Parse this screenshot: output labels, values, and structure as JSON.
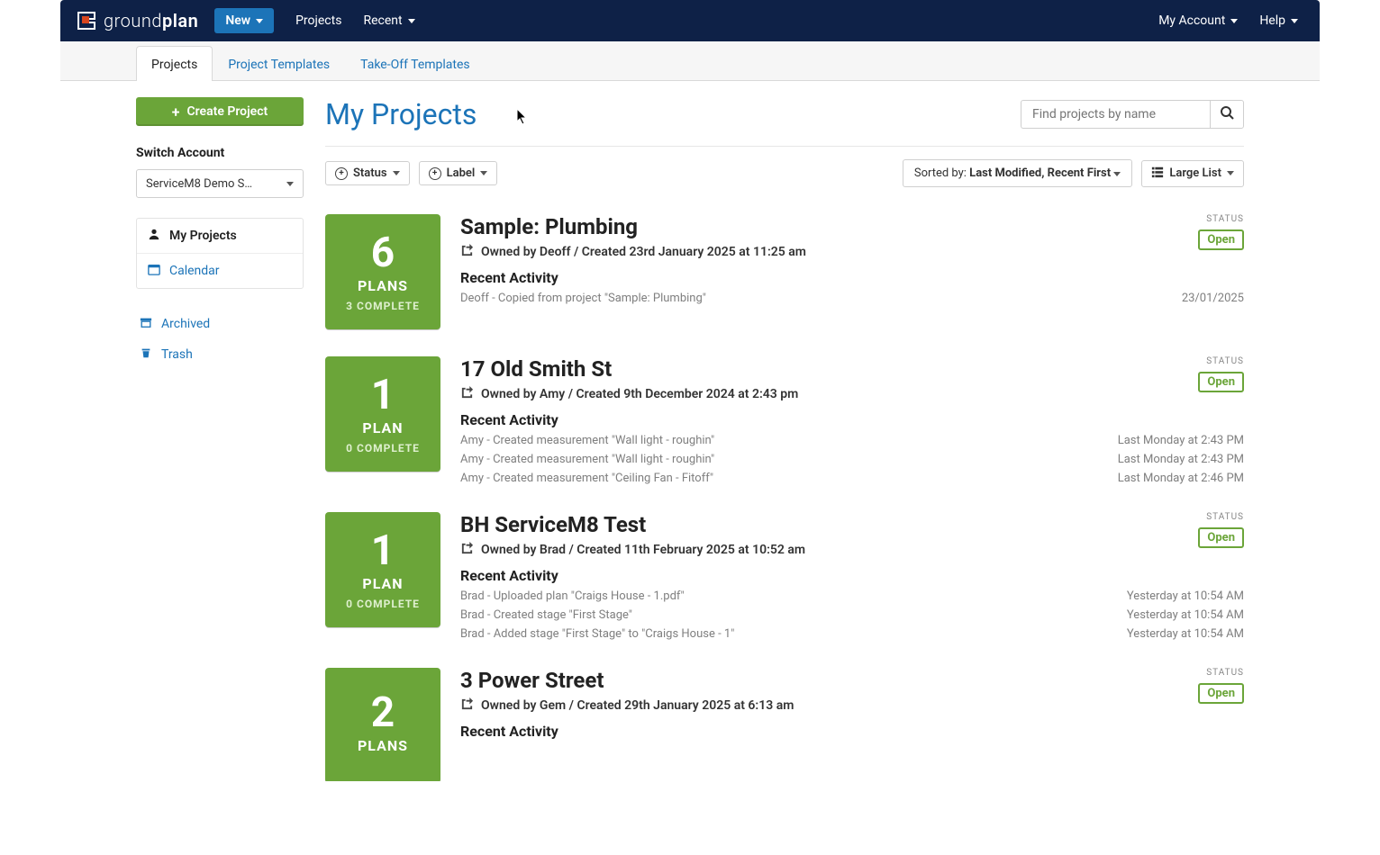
{
  "nav": {
    "new": "New",
    "projects": "Projects",
    "recent": "Recent",
    "myaccount": "My Account",
    "help": "Help",
    "brand1": "ground",
    "brand2": "plan"
  },
  "tabs": {
    "projects": "Projects",
    "projTemplates": "Project Templates",
    "takeoff": "Take-Off Templates"
  },
  "sidebar": {
    "create": "Create Project",
    "switch": "Switch Account",
    "account": "ServiceM8 Demo S…",
    "myprojects": "My Projects",
    "calendar": "Calendar",
    "archived": "Archived",
    "trash": "Trash"
  },
  "head": {
    "title": "My Projects",
    "searchPH": "Find projects by name"
  },
  "filters": {
    "status": "Status",
    "label": "Label",
    "sortedPrefix": "Sorted by: ",
    "sortedValue": "Last Modified, Recent First",
    "listMode": "Large List"
  },
  "statusLabel": "STATUS",
  "recentActivity": "Recent Activity",
  "projects": [
    {
      "tile": {
        "count": "6",
        "word": "PLANS",
        "complete": "3 COMPLETE"
      },
      "title": "Sample: Plumbing",
      "owned": "Owned by Deoff / Created 23rd January 2025 at 11:25 am",
      "status": "Open",
      "activity": [
        {
          "text": "Deoff - Copied from project \"Sample: Plumbing\"",
          "time": "23/01/2025"
        }
      ]
    },
    {
      "tile": {
        "count": "1",
        "word": "PLAN",
        "complete": "0 COMPLETE"
      },
      "title": "17 Old Smith St",
      "owned": "Owned by Amy / Created 9th December 2024 at 2:43 pm",
      "status": "Open",
      "activity": [
        {
          "text": "Amy - Created measurement \"Wall light - roughin\"",
          "time": "Last Monday at 2:43 PM"
        },
        {
          "text": "Amy - Created measurement \"Wall light - roughin\"",
          "time": "Last Monday at 2:43 PM"
        },
        {
          "text": "Amy - Created measurement \"Ceiling Fan - Fitoff\"",
          "time": "Last Monday at 2:46 PM"
        }
      ]
    },
    {
      "tile": {
        "count": "1",
        "word": "PLAN",
        "complete": "0 COMPLETE"
      },
      "title": "BH ServiceM8 Test",
      "owned": "Owned by Brad / Created 11th February 2025 at 10:52 am",
      "status": "Open",
      "activity": [
        {
          "text": "Brad - Uploaded plan \"Craigs House - 1.pdf\"",
          "time": "Yesterday at 10:54 AM"
        },
        {
          "text": "Brad - Created stage \"First Stage\"",
          "time": "Yesterday at 10:54 AM"
        },
        {
          "text": "Brad - Added stage \"First Stage\" to \"Craigs House - 1\"",
          "time": "Yesterday at 10:54 AM"
        }
      ]
    },
    {
      "tile": {
        "count": "2",
        "word": "PLANS",
        "complete": ""
      },
      "title": "3 Power Street",
      "owned": "Owned by Gem / Created 29th January 2025 at 6:13 am",
      "status": "Open",
      "activity": []
    }
  ]
}
